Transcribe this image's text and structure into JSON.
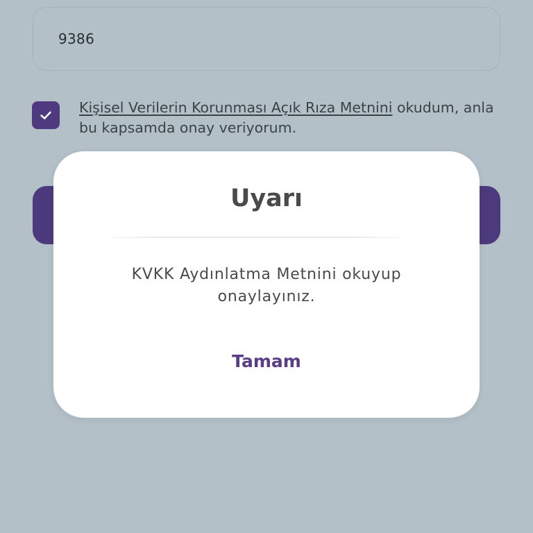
{
  "form": {
    "input_value": "9386",
    "consent": {
      "checked": true,
      "link_text": "Kişisel Verilerin Korunması Açık Rıza Metnini",
      "text_after_link": " okudum, anla",
      "text_line2": "bu kapsamda onay veriyorum."
    }
  },
  "dialog": {
    "title": "Uyarı",
    "message": "KVKK Aydınlatma Metnini okuyup onaylayınız.",
    "ok_label": "Tamam"
  },
  "colors": {
    "background": "#b3c0c8",
    "accent": "#4d3a7e",
    "dialog_button_text": "#5a3d85"
  },
  "icons": {
    "checkbox": "check-icon"
  }
}
